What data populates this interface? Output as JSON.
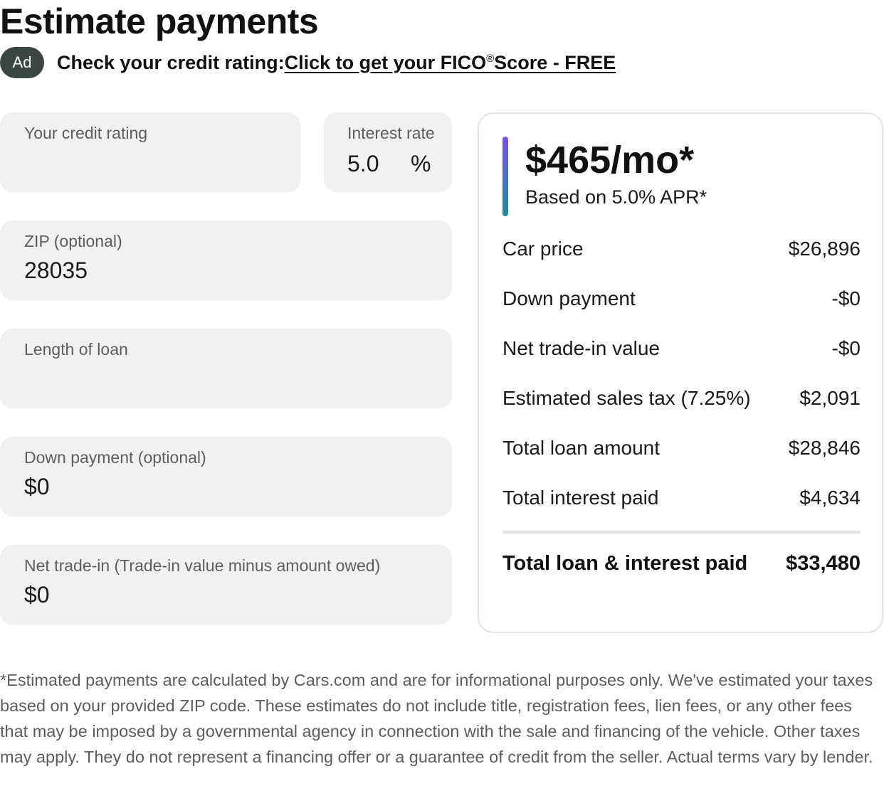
{
  "page": {
    "title": "Estimate payments"
  },
  "ad": {
    "badge": "Ad",
    "text": "Check your credit rating:",
    "link_part1": "Click to get your FICO",
    "link_reg": "®",
    "link_part2": "Score - FREE"
  },
  "form": {
    "credit_rating": {
      "label": "Your credit rating",
      "value": ""
    },
    "interest_rate": {
      "label": "Interest rate",
      "value": "5.0",
      "unit": "%"
    },
    "zip": {
      "label": "ZIP (optional)",
      "value": "28035"
    },
    "loan_length": {
      "label": "Length of loan",
      "value": ""
    },
    "down_payment": {
      "label": "Down payment (optional)",
      "value": "$0"
    },
    "net_trade_in": {
      "label": "Net trade-in (Trade-in value minus amount owed)",
      "value": "$0"
    }
  },
  "summary": {
    "monthly": "$465/mo*",
    "apr_note": "Based on 5.0% APR*",
    "rows": [
      {
        "label": "Car price",
        "value": "$26,896"
      },
      {
        "label": "Down payment",
        "value": "-$0"
      },
      {
        "label": "Net trade-in value",
        "value": "-$0"
      },
      {
        "label": "Estimated sales tax (7.25%)",
        "value": "$2,091"
      },
      {
        "label": "Total loan amount",
        "value": "$28,846"
      },
      {
        "label": "Total interest paid",
        "value": "$4,634"
      }
    ],
    "total": {
      "label": "Total loan & interest paid",
      "value": "$33,480"
    }
  },
  "disclaimer": "*Estimated payments are calculated by Cars.com and are for informational purposes only. We've estimated your taxes based on your provided ZIP code. These estimates do not include title, registration fees, lien fees, or any other fees that may be imposed by a governmental agency in connection with the sale and financing of the vehicle. Other taxes may apply. They do not represent a financing offer or a guarantee of credit from the seller. Actual terms vary by lender.",
  "colors": {
    "field_bg": "#f0f1f0",
    "ad_badge": "#3a4544",
    "accent_top": "#7b4fd9",
    "accent_bottom": "#1a8f9a"
  }
}
